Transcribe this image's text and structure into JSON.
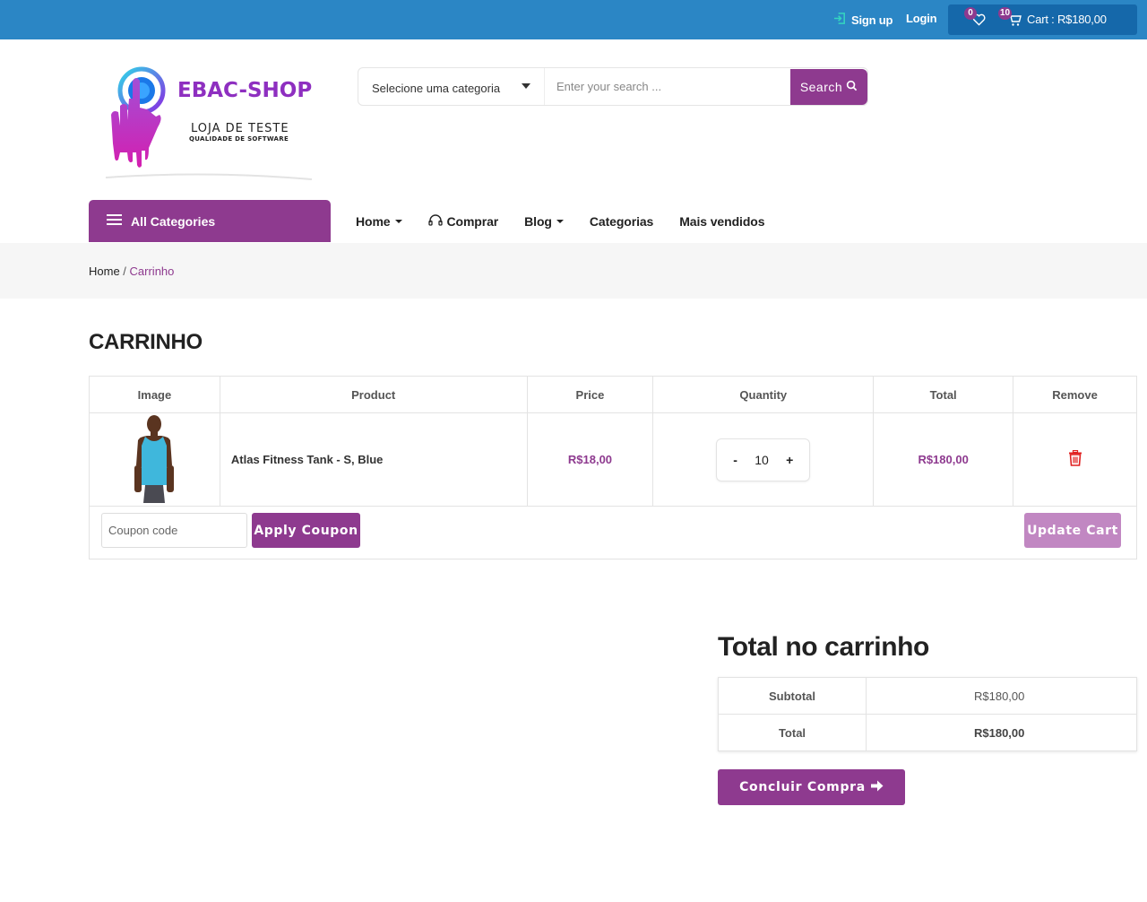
{
  "topbar": {
    "signup_label": "Sign up",
    "login_label": "Login",
    "wishlist_count": "0",
    "cart_count": "10",
    "cart_label": "Cart : R$180,00"
  },
  "brand": {
    "name": "EBAC-SHOP",
    "tagline": "LOJA DE TESTE",
    "subtagline": "QUALIDADE DE SOFTWARE"
  },
  "search": {
    "category_label": "Selecione uma categoria",
    "placeholder": "Enter your search ...",
    "button_label": "Search"
  },
  "nav": {
    "all_categories": "All Categories",
    "items": [
      "Home",
      "Comprar",
      "Blog",
      "Categorias",
      "Mais vendidos"
    ]
  },
  "breadcrumb": {
    "home": "Home",
    "separator": " / ",
    "current": "Carrinho"
  },
  "page_title": "CARRINHO",
  "cart": {
    "headers": [
      "Image",
      "Product",
      "Price",
      "Quantity",
      "Total",
      "Remove"
    ],
    "rows": [
      {
        "product": "Atlas Fitness Tank - S, Blue",
        "price": "R$18,00",
        "minus": "-",
        "quantity": "10",
        "plus": "+",
        "total": "R$180,00"
      }
    ],
    "coupon_placeholder": "Coupon code",
    "apply_coupon": "Apply Coupon",
    "update_cart": "Update Cart"
  },
  "totals": {
    "title": "Total no carrinho",
    "subtotal_label": "Subtotal",
    "subtotal_value": "R$180,00",
    "total_label": "Total",
    "total_value": "R$180,00",
    "checkout_label": "Concluir Compra"
  },
  "colors": {
    "topbar": "#2b86c5",
    "accent": "#8e3a8f",
    "remove_icon": "#e02020",
    "signup_icon": "#35d6c0"
  },
  "icons": [
    "signup-icon",
    "heart-icon",
    "cart-icon",
    "search-icon",
    "menu-icon",
    "headset-icon",
    "trash-icon",
    "arrow-right-icon"
  ]
}
